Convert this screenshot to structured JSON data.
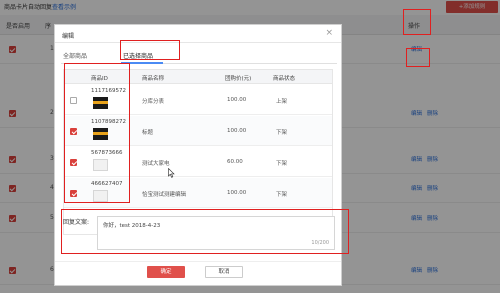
{
  "page": {
    "title": "商品卡片自动回复",
    "title_link": "查看示例",
    "add_button": "+添加规则",
    "columns": {
      "enabled": "是否启用",
      "seq": "序",
      "operation": "操作"
    },
    "rows": [
      {
        "num": "1",
        "edit": "编辑",
        "delete": "删除"
      },
      {
        "num": "2",
        "edit": "编辑",
        "delete": "删除"
      },
      {
        "num": "3",
        "edit": "编辑",
        "delete": "删除"
      },
      {
        "num": "4",
        "edit": "编辑",
        "delete": "删除"
      },
      {
        "num": "5",
        "edit": "编辑",
        "delete": "删除"
      },
      {
        "num": "6",
        "edit": "编辑",
        "delete": "删除"
      }
    ]
  },
  "modal": {
    "title": "编辑",
    "close_symbol": "×",
    "tabs": [
      "全部商品",
      "已选择商品"
    ],
    "table_headers": {
      "id": "商品ID",
      "name": "商品名称",
      "price": "团购价(元)",
      "status": "商品状态"
    },
    "items": [
      {
        "id": "1117169572",
        "name": "分库分表",
        "price": "100.00",
        "status": "上架",
        "checked": false
      },
      {
        "id": "1107898272",
        "name": "标题",
        "price": "100.00",
        "status": "下架",
        "checked": true
      },
      {
        "id": "567873666",
        "name": "测试大家电",
        "price": "60.00",
        "status": "下架",
        "checked": true
      },
      {
        "id": "466627407",
        "name": "恰宝测试测建编辑",
        "price": "100.00",
        "status": "下架",
        "checked": true
      }
    ],
    "reply_label": "回复文案:",
    "reply_text": "你好，test  2018-4-23",
    "reply_count": "10/200",
    "ok_button": "确定",
    "cancel_button": "取消"
  },
  "colors": {
    "accent": "#e0504b",
    "link": "#2a6fdb",
    "annotation": "#e02020",
    "tab_active": "#4a8af4"
  }
}
